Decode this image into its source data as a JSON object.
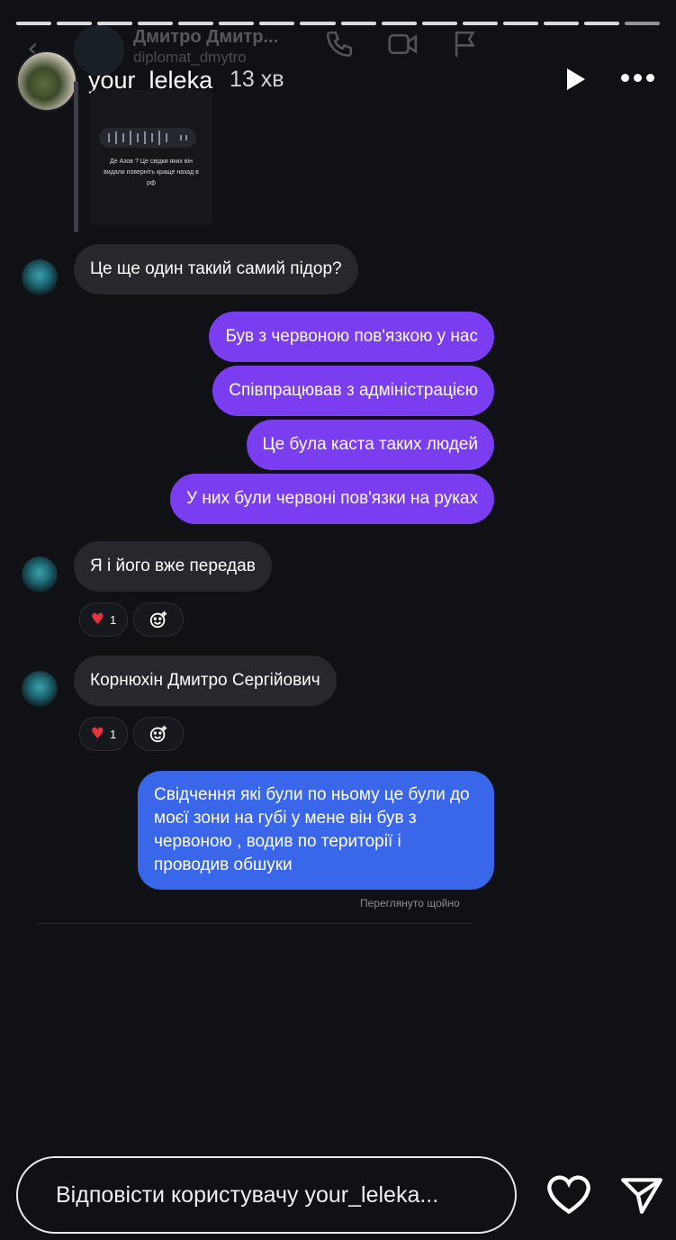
{
  "background_chat": {
    "name": "Дмитро Дмитр...",
    "username": "diplomat_dmytro"
  },
  "story": {
    "username": "your_leleka",
    "time_ago": "13 хв"
  },
  "preview": {
    "top_caption": "",
    "message": "Де Азов ? Це свідки яких він видали поверніть краще назад в рф"
  },
  "messages": [
    {
      "side": "in",
      "text": "Це ще один такий самий підор?"
    },
    {
      "side": "out",
      "text": "Був з червоною пов'язкою у нас"
    },
    {
      "side": "out",
      "text": "Співпрацював з адміністрацією"
    },
    {
      "side": "out",
      "text": "Це була каста таких людей"
    },
    {
      "side": "out",
      "text": "У них були червоні пов'язки на руках"
    },
    {
      "side": "in",
      "text": "Я і його вже передав",
      "reaction_count": "1"
    },
    {
      "side": "in",
      "text": "Корнюхін Дмитро Сергійович",
      "reaction_count": "1"
    },
    {
      "side": "out",
      "text": "Свідчення які були по ньому це були до моєї зони на губі у мене він був з червоною , водив по території і проводив обшуки"
    }
  ],
  "seen_status": "Переглянуто щойно",
  "reply": {
    "placeholder": "Відповісти користувачу your_leleka..."
  },
  "colors": {
    "outgoing_purple": "#7a3df0",
    "outgoing_blue": "#3a67ea",
    "incoming": "#26282e",
    "background": "#0f1115"
  }
}
